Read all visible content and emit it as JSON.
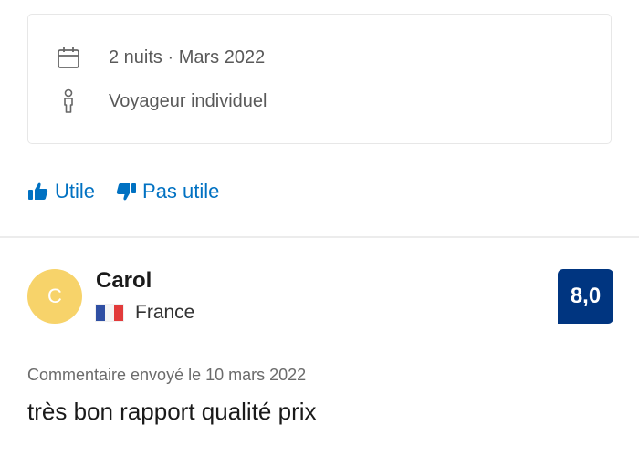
{
  "stay": {
    "dates": "2 nuits · Mars 2022",
    "traveler_type": "Voyageur individuel",
    "icons": {
      "dates": "calendar-icon",
      "traveler": "person-icon"
    }
  },
  "feedback": {
    "helpful_label": "Utile",
    "not_helpful_label": "Pas utile",
    "icons": {
      "helpful": "thumbs-up-icon",
      "not_helpful": "thumbs-down-icon"
    }
  },
  "review": {
    "avatar_initial": "C",
    "reviewer_name": "Carol",
    "country": "France",
    "flag": "france-flag-icon",
    "score": "8,0",
    "submitted": "Commentaire envoyé le 10 mars 2022",
    "text": "très bon rapport qualité prix"
  },
  "colors": {
    "link_blue": "#0071c2",
    "score_badge_bg": "#003580",
    "avatar_bg": "#f7d36a",
    "muted_text": "#6b6b6b"
  }
}
